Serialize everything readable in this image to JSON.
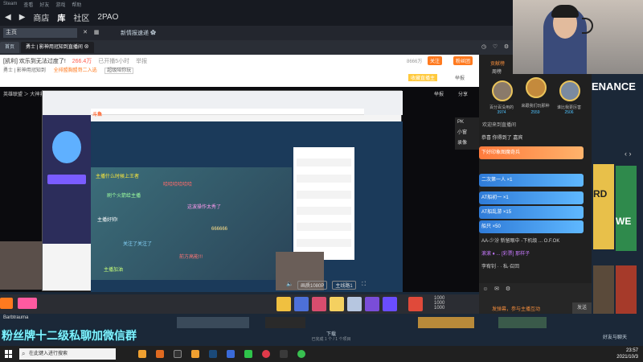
{
  "steam": {
    "menu": [
      "Steam",
      "查看",
      "好友",
      "游戏",
      "帮助"
    ],
    "nav": {
      "back": "◀",
      "forward": "▶",
      "store": "商店",
      "library": "库",
      "community": "社区",
      "user": "2PAO"
    },
    "url_value": "主页",
    "new_info": "新情报速递 ✿"
  },
  "browser": {
    "tabs": [
      {
        "label": "首页"
      },
      {
        "label": "勇士 | 影神用冠知到直播间 ⊗"
      }
    ]
  },
  "room": {
    "title": "[凯利] 欢乐到无法过度了!",
    "heat": "266.4万",
    "time_label": "已开播5小时",
    "report": "举报",
    "subline_a": "勇士 | 影神用冠知到",
    "subline_b": "全排盟胸盟哥二入选",
    "subline_c": "超级陪你玩",
    "follow_label": "关注",
    "follow_count": "8666万",
    "btn_a": "关注",
    "btn_b": "粉丝团",
    "bookmarks": "收藏直播主",
    "share_label": "分享",
    "report_label": "举报",
    "breadcrumb": "英雄联盟 ＞ 大神救我"
  },
  "video": {
    "side_controls": [
      "PK",
      "小窗",
      "录像"
    ],
    "controls": [
      "画质1080P",
      "主线路1",
      "全屏"
    ]
  },
  "danmaku": [
    "主播什么时候上王者",
    "哈哈哈哈哈哈",
    "刷个火箭给主播",
    "这波操作太秀了",
    "主播好帅!",
    "666666",
    "关注了关注了",
    "前方高能!!!",
    "主播加油"
  ],
  "ranks": {
    "title": "贡献榜",
    "subtitle": "周榜",
    "users": [
      {
        "name": "百分百没用的",
        "score": "3974"
      },
      {
        "name": "来跟我们玩那种",
        "score": "2559"
      },
      {
        "name": "谁比我更厉害",
        "score": "2506"
      }
    ]
  },
  "chat": {
    "header": "欢迎来到直播间",
    "items": [
      {
        "text": "恭喜 你得到了 嘉宾"
      },
      {
        "text": "下好印象图魔奇兵"
      },
      {
        "text": "二次第一人 ×1"
      },
      {
        "text": "AT船初一 ×1"
      },
      {
        "text": "AT船乱游 ×15"
      },
      {
        "text": "船只 ×50"
      },
      {
        "text": "AA-少汾 新留眼中 -下机级 ... O.F.OK"
      },
      {
        "text": "滚滚 ♦ ... [彩票] 那样子"
      },
      {
        "text": "李宥钊 · · 私·召回"
      }
    ],
    "hint": "发弹幕，参与主播互动",
    "send_label": "发送"
  },
  "store": {
    "banner_text": "ENANCE",
    "cover_text_a": "RD",
    "cover_text_b": "WE"
  },
  "gifts": {
    "stat_a": "1000",
    "stat_b": "1000",
    "stat_c": "1000"
  },
  "library": {
    "friend_label": "Barbtrauma",
    "download_label": "下载",
    "download_sub": "已完成 1 个 / 1 个项目",
    "friends_chat": "好友与聊天"
  },
  "caption": "粉丝牌十二级私聊加微信群",
  "taskbar": {
    "search_placeholder": "在此键入进行搜索",
    "time": "23:57",
    "date": "2021/10/3"
  },
  "colors": {
    "steam_bg": "#1b2838",
    "accent_orange": "#ff7a1f",
    "caption_cyan": "#7ff3ff"
  }
}
